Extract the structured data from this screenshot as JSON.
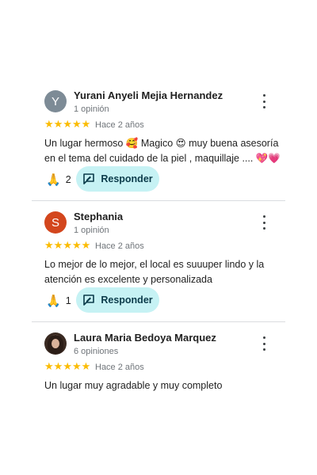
{
  "reviews": [
    {
      "avatar_letter": "Y",
      "name": "Yurani Anyeli Mejia Hernandez",
      "count": "1 opinión",
      "rating": 5,
      "time": "Hace 2 años",
      "text": "Un lugar hermoso 🥰 Magico 😍 muy buena asesoría en el tema del cuidado de la piel , maquillaje .... 💖💗",
      "reactions": "2",
      "reply_label": "Responder"
    },
    {
      "avatar_letter": "S",
      "name": "Stephania",
      "count": "1 opinión",
      "rating": 5,
      "time": "Hace 2 años",
      "text": "Lo mejor de lo mejor, el local es suuuper lindo y la atención es excelente y personalizada",
      "reactions": "1",
      "reply_label": "Responder"
    },
    {
      "avatar_letter": "",
      "name": "Laura Maria Bedoya Marquez",
      "count": "6 opiniones",
      "rating": 5,
      "time": "Hace 2 años",
      "text": "Un lugar muy agradable y muy completo"
    }
  ],
  "icons": {
    "star": "★",
    "reaction": "🙏",
    "more": "more-vert-icon",
    "reply": "reply-edit-icon"
  },
  "colors": {
    "star": "#fbbc04",
    "reply_bg": "#c6f2f4",
    "avatar_gray": "#7d8b96",
    "avatar_orange": "#d3461d"
  }
}
